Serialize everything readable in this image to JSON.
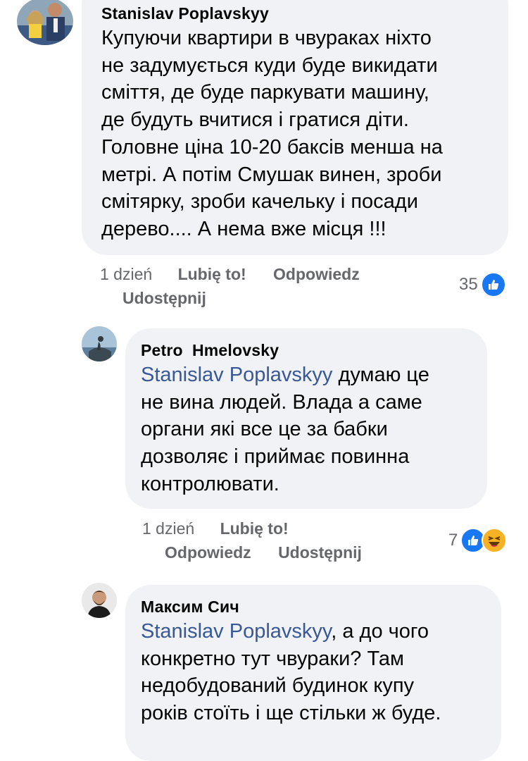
{
  "comments": [
    {
      "author": "Stanislav Poplavskyy",
      "mention": "",
      "lines": [
        "Купуючи квартири в чвураках ніхто",
        "не задумується куди буде викидати",
        "сміття, де буде паркувати машину,",
        "де будуть вчитися і гратися діти.",
        "Головне ціна 10-20 баксів менша на",
        "метрі.  А потім Смушак винен, зроби",
        "смітярку, зроби качельку і посади",
        "дерево.... А нема вже місця !!!"
      ],
      "time": "1 dzień",
      "like_label": "Lubię to!",
      "reply_label": "Odpowiedz",
      "share_label": "Udostępnij",
      "reaction_count": "35",
      "reactions": [
        "like-icon"
      ]
    },
    {
      "author": "Petro  Hmelovsky",
      "mention": "Stanislav Poplavskyy",
      "first_line_rest": " думаю це",
      "lines": [
        "не вина людей. Влада а саме",
        "органи які все це за бабки",
        "дозволяє і приймає повинна",
        "контролювати."
      ],
      "time": "1 dzień",
      "like_label": "Lubię to!",
      "reply_label": "Odpowiedz",
      "share_label": "Udostępnij",
      "reaction_count": "7",
      "reactions": [
        "like-icon",
        "haha-icon"
      ]
    },
    {
      "author": "Максим Сич",
      "mention": "Stanislav Poplavskyy",
      "first_line_rest": ", а до чого",
      "lines": [
        "конкретно тут чвураки? Там",
        "недобудований будинок купу",
        "років стоїть і ще стільки ж буде."
      ]
    }
  ],
  "colors": {
    "bubble": "#f0f2f5",
    "mention": "#385898",
    "meta": "#65676b",
    "like": "#1877f2",
    "haha": "#f7b125"
  }
}
